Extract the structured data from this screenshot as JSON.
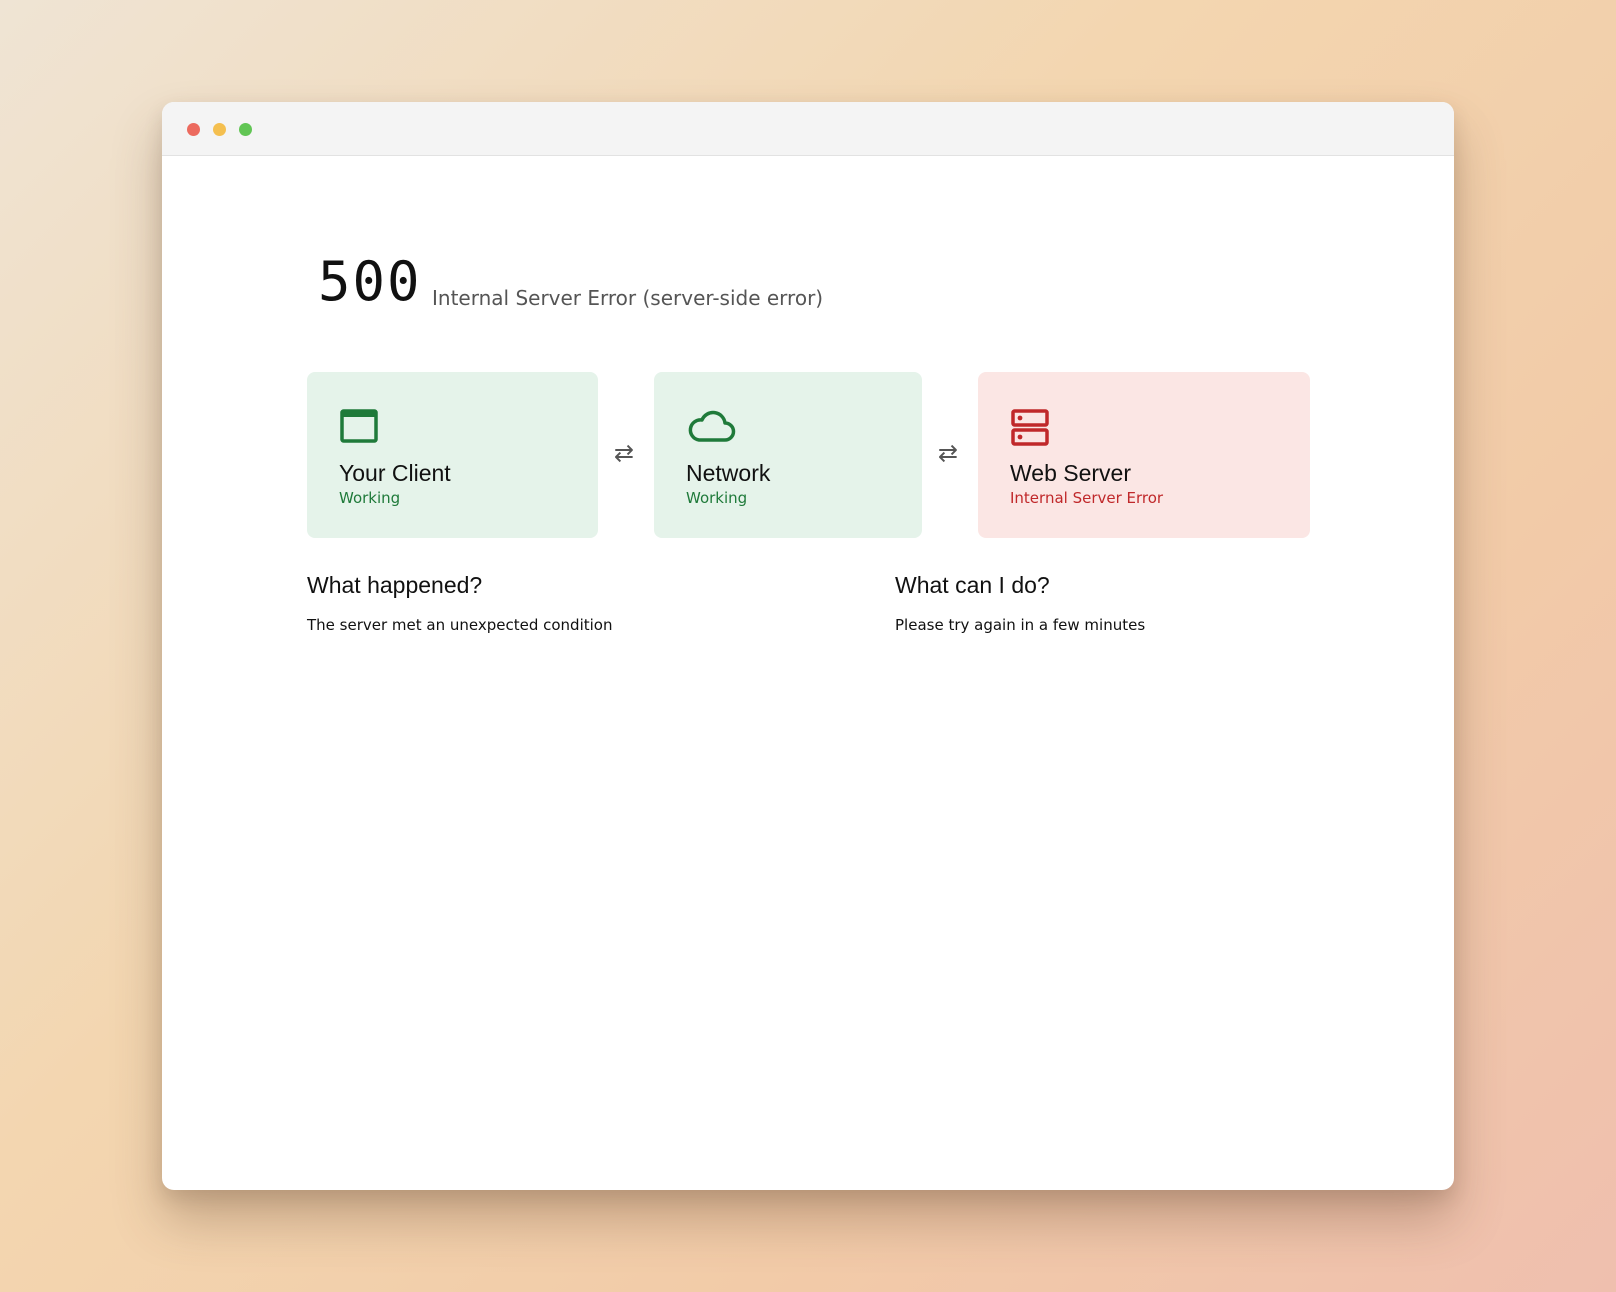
{
  "window": {
    "controls": [
      "close",
      "minimize",
      "maximize"
    ]
  },
  "error": {
    "code": "500",
    "description": "Internal Server Error (server-side error)"
  },
  "status_cards": [
    {
      "title": "Your Client",
      "status": "Working",
      "icon": "browser-window-icon",
      "state": "ok"
    },
    {
      "title": "Network",
      "status": "Working",
      "icon": "cloud-icon",
      "state": "ok"
    },
    {
      "title": "Web Server",
      "status": "Internal Server Error",
      "icon": "server-icon",
      "state": "error"
    }
  ],
  "connector_glyph": "⇄",
  "sections": {
    "what_happened": {
      "title": "What happened?",
      "text": "The server met an unexpected condition"
    },
    "what_can_i_do": {
      "title": "What can I do?",
      "text": "Please try again in a few minutes"
    }
  },
  "colors": {
    "ok_bg": "#e5f3ea",
    "ok_fg": "#1f7a3a",
    "error_bg": "#fbe6e4",
    "error_fg": "#c0282a"
  }
}
